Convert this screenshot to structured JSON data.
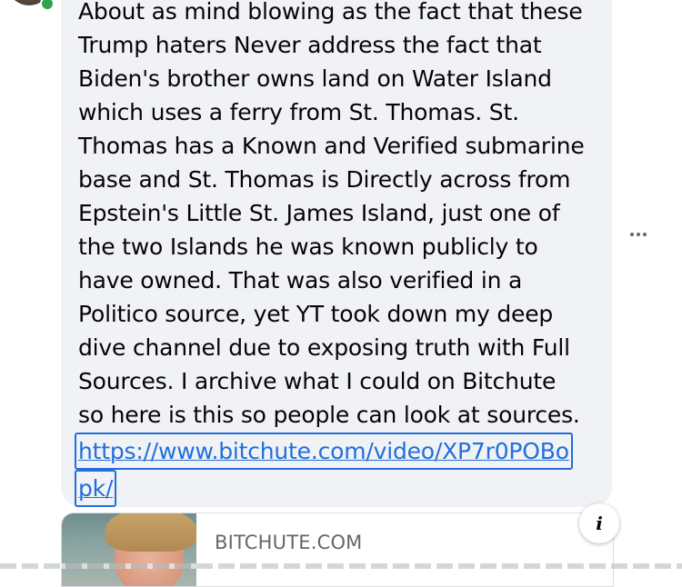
{
  "comment": {
    "text": "About as mind blowing as the fact that these\nTrump haters Never address the fact that\nBiden's brother owns land on Water Island\nwhich uses a ferry from St. Thomas. St.\nThomas has a Known and Verified submarine\nbase and St. Thomas is Directly across from\nEpstein's Little St. James Island, just one of\nthe two Islands he was known publicly to\nhave owned. That was also verified in a\nPolitico source, yet YT took down my deep\ndive channel due to exposing truth with Full\nSources. I archive what I could on Bitchute\nso here is this so people can look at sources.",
    "link_line_1": "https://www.bitchute.com/video/XP7r0POBo",
    "link_line_2": "pk/"
  },
  "more_button": {
    "icon": "more-horizontal-icon"
  },
  "link_preview": {
    "domain": "BITCHUTE.COM",
    "info_icon_glyph": "i"
  },
  "colors": {
    "bubble": "#f0f2f5",
    "link": "#216fdb",
    "presence": "#31a24c",
    "secondary_text": "#65676b"
  }
}
